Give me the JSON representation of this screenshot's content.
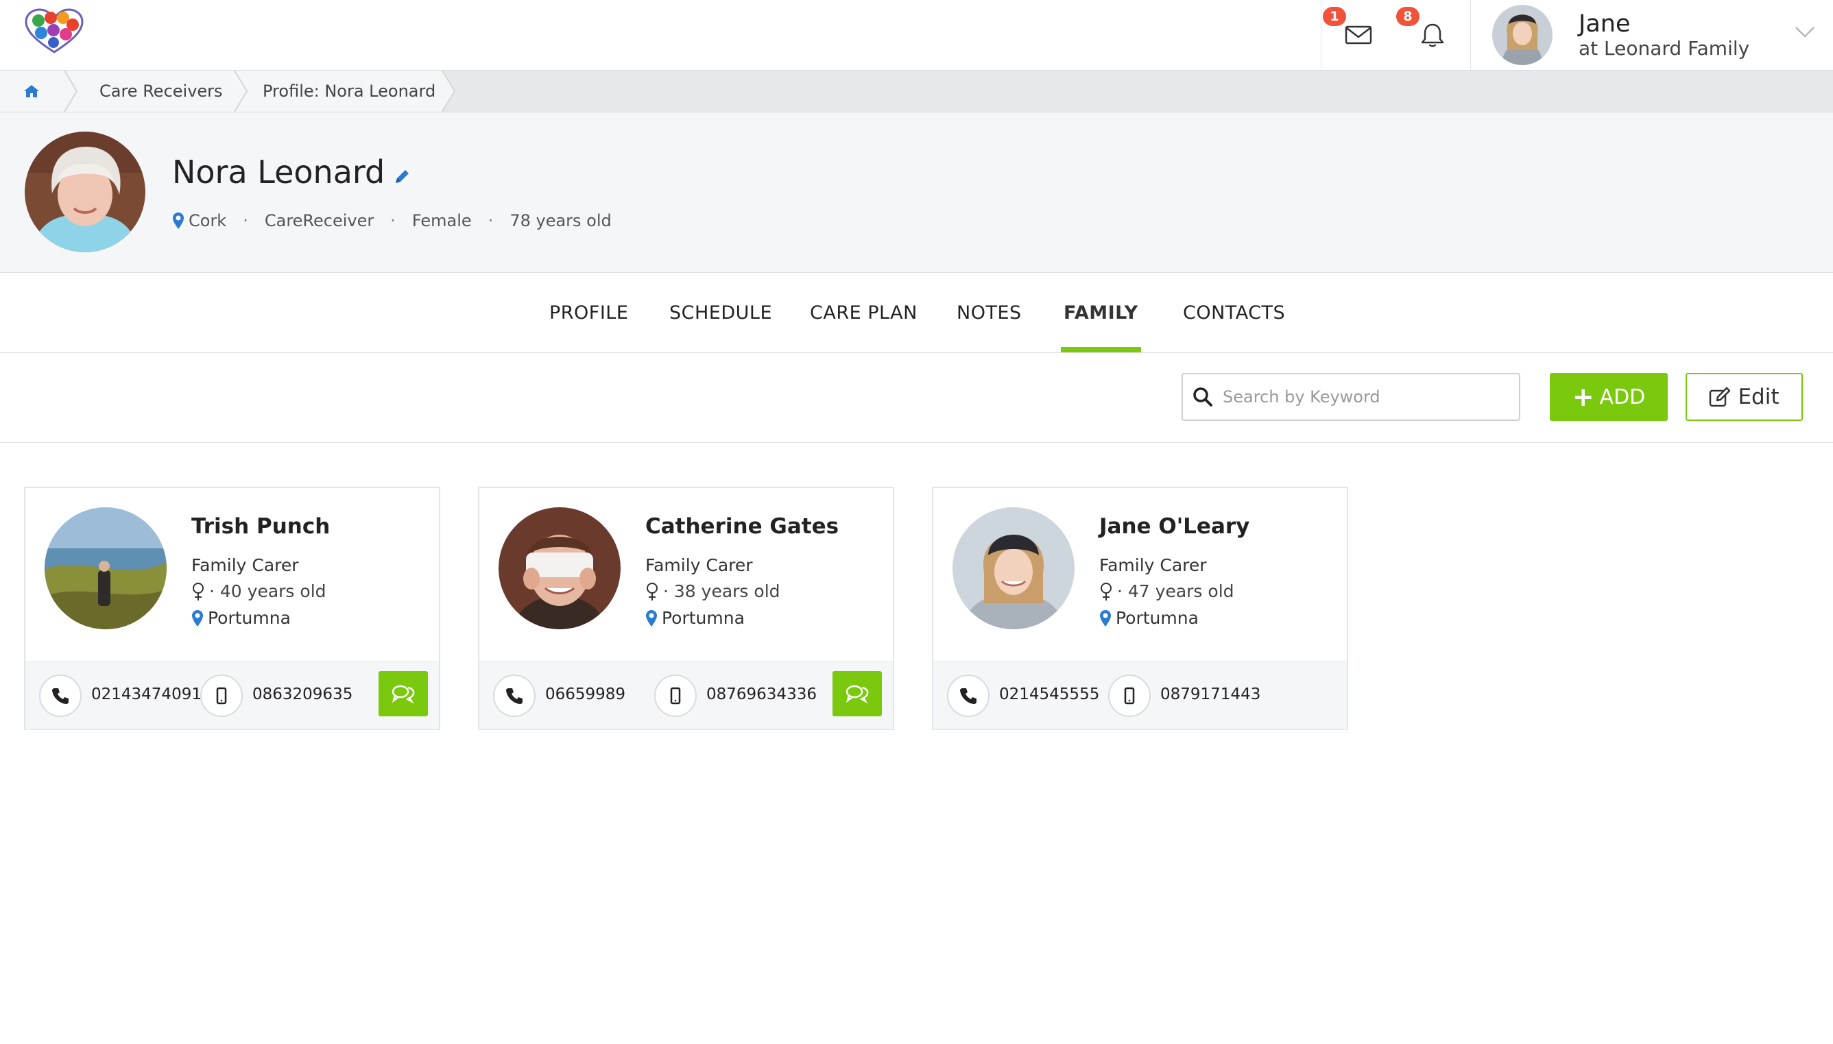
{
  "topbar": {
    "messages_badge": "1",
    "notifications_badge": "8",
    "user_name": "Jane",
    "user_family": "at Leonard Family"
  },
  "breadcrumb": {
    "items": [
      "Care Receivers",
      "Profile: Nora Leonard"
    ]
  },
  "profile": {
    "name": "Nora Leonard",
    "location": "Cork",
    "role": "CareReceiver",
    "gender": "Female",
    "age": "78 years old"
  },
  "tabs": [
    {
      "label": "PROFILE",
      "active": false
    },
    {
      "label": "SCHEDULE",
      "active": false
    },
    {
      "label": "CARE PLAN",
      "active": false
    },
    {
      "label": "NOTES",
      "active": false
    },
    {
      "label": "FAMILY",
      "active": true
    },
    {
      "label": "CONTACTS",
      "active": false
    }
  ],
  "toolbar": {
    "search_placeholder": "Search by Keyword",
    "add_label": "ADD",
    "edit_label": "Edit"
  },
  "family": [
    {
      "name": "Trish Punch",
      "role": "Family Carer",
      "age": "· 40 years old",
      "location": "Portumna",
      "phone": "02143474091",
      "mobile": "0863209635",
      "has_chat": true
    },
    {
      "name": "Catherine Gates",
      "role": "Family Carer",
      "age": "· 38 years old",
      "location": "Portumna",
      "phone": "06659989",
      "mobile": "08769634336",
      "has_chat": true
    },
    {
      "name": "Jane O'Leary",
      "role": "Family Carer",
      "age": "· 47 years old",
      "location": "Portumna",
      "phone": "0214545555",
      "mobile": "0879171443",
      "has_chat": false
    }
  ],
  "colors": {
    "accent_green": "#7ac90f",
    "badge_red": "#f0533a",
    "link_blue": "#2a7bd1"
  }
}
